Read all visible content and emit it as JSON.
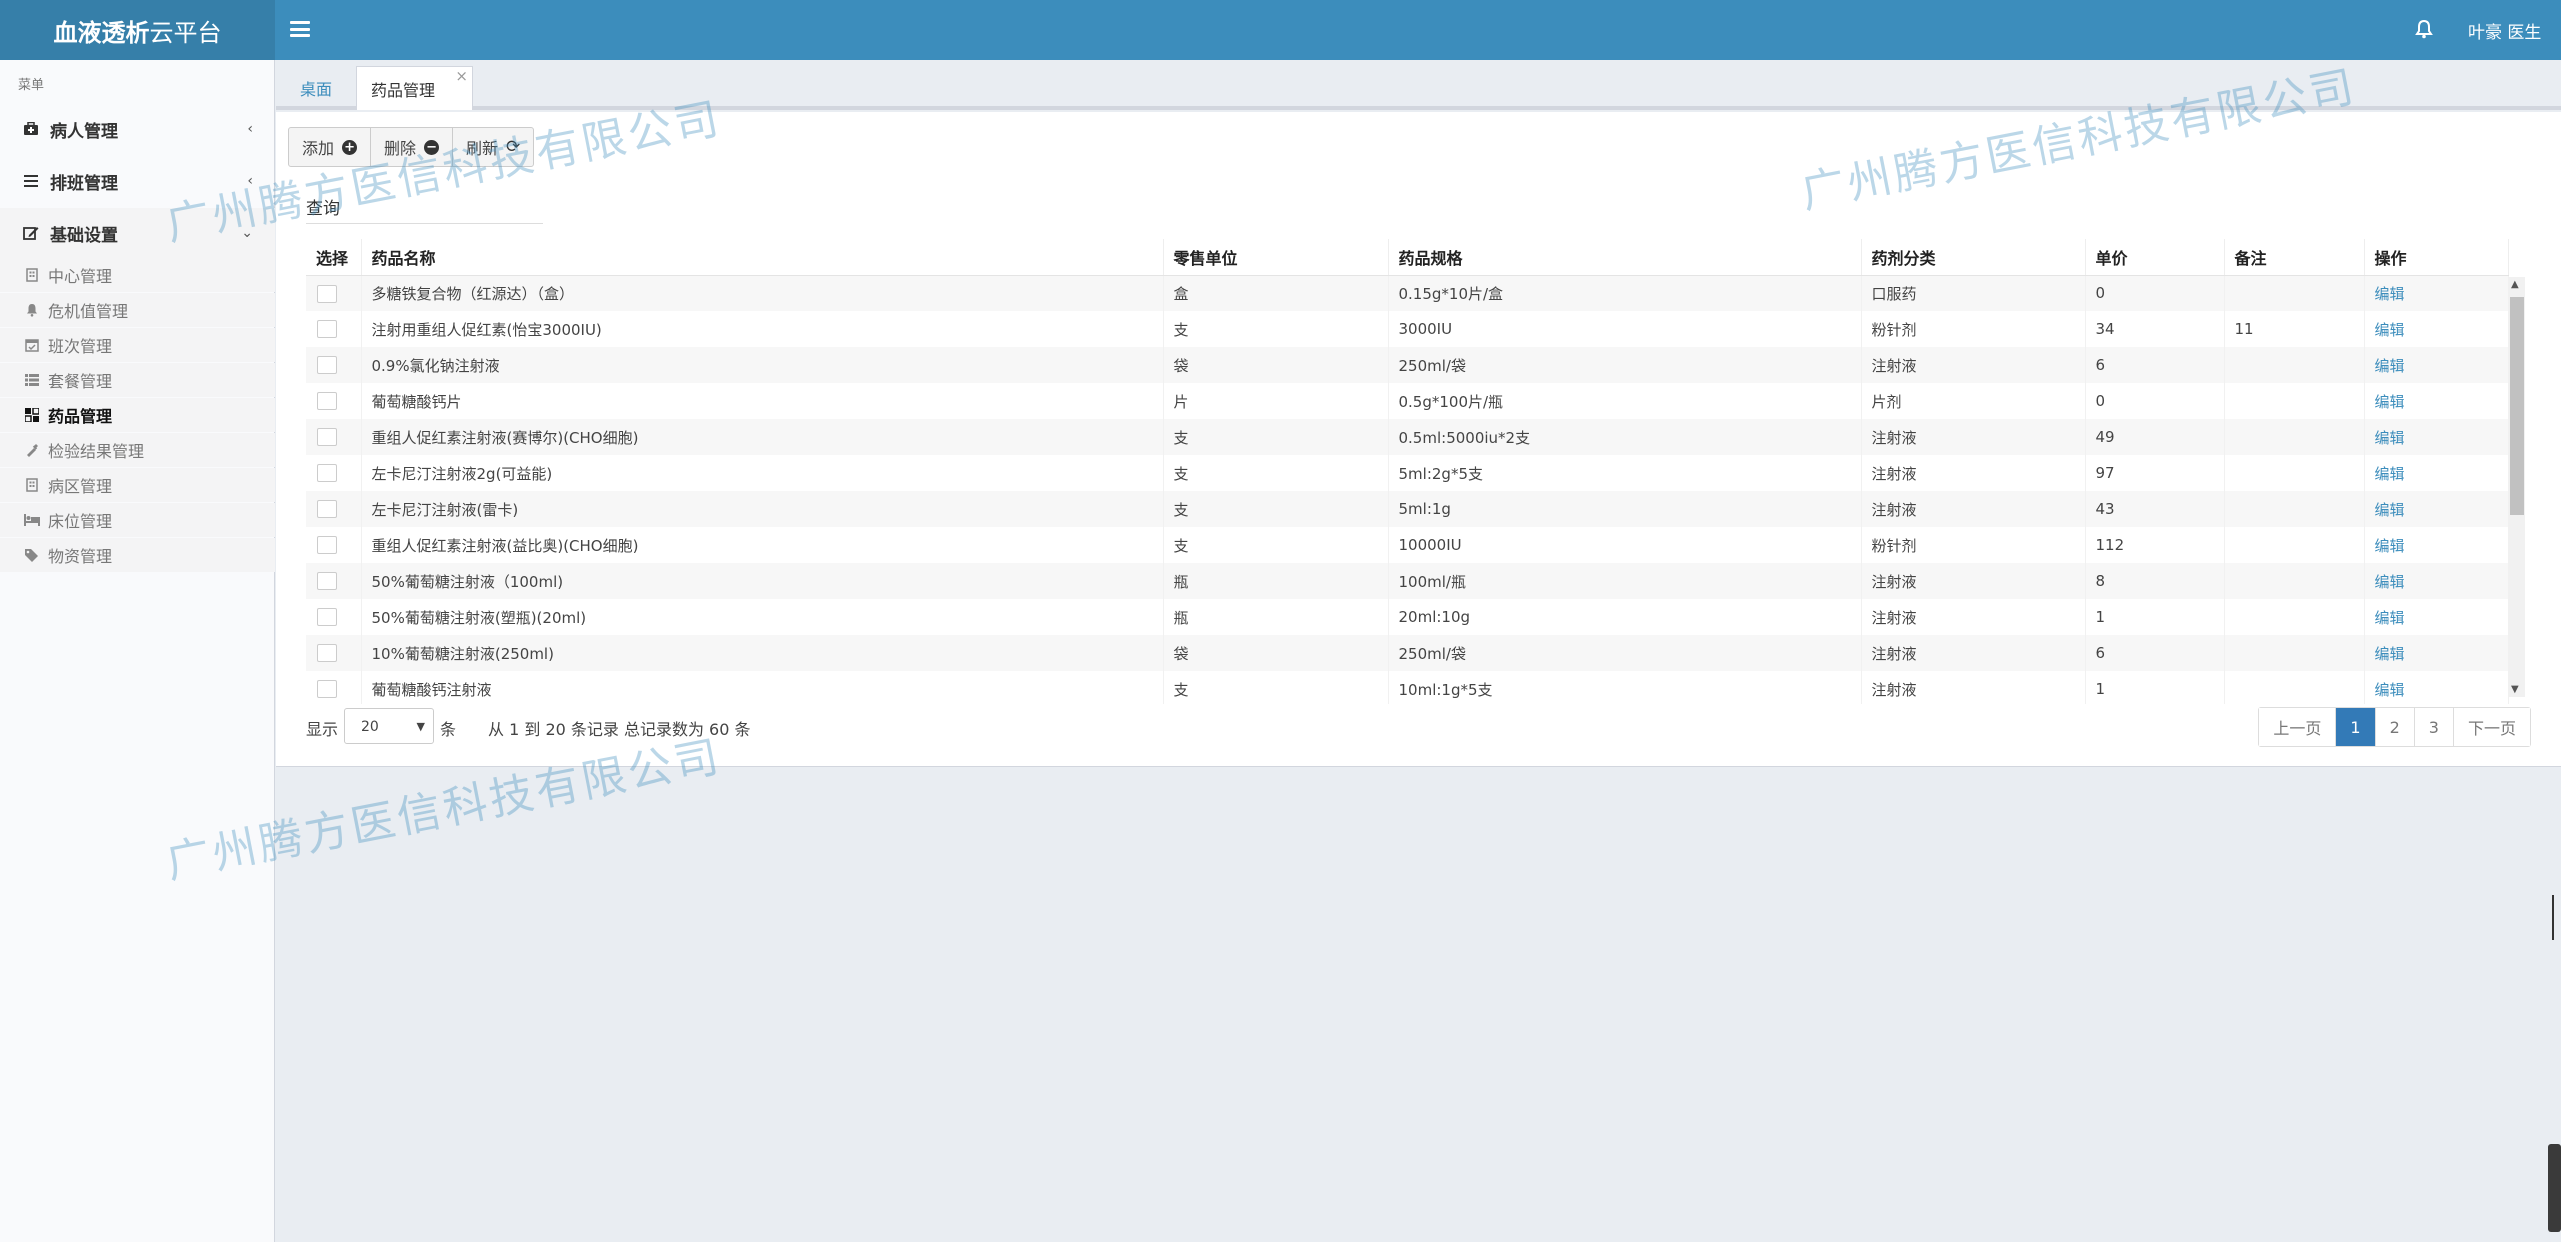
{
  "header": {
    "brand_bold": "血液透析",
    "brand_light": "云平台",
    "user": "叶豪 医生"
  },
  "sidebar": {
    "menu_header": "菜单",
    "main_items": [
      {
        "label": "病人管理",
        "icon": "medkit-icon",
        "chevron": "‹"
      },
      {
        "label": "排班管理",
        "icon": "list-icon",
        "chevron": "‹"
      },
      {
        "label": "基础设置",
        "icon": "edit-icon",
        "chevron": "⌄"
      }
    ],
    "sub_items": [
      {
        "label": "中心管理",
        "icon": "building-icon"
      },
      {
        "label": "危机值管理",
        "icon": "bell-icon"
      },
      {
        "label": "班次管理",
        "icon": "calendar-icon"
      },
      {
        "label": "套餐管理",
        "icon": "list-icon"
      },
      {
        "label": "药品管理",
        "icon": "drug-icon"
      },
      {
        "label": "检验结果管理",
        "icon": "dropper-icon"
      },
      {
        "label": "病区管理",
        "icon": "building-icon"
      },
      {
        "label": "床位管理",
        "icon": "bed-icon"
      },
      {
        "label": "物资管理",
        "icon": "tags-icon"
      }
    ]
  },
  "tabs": {
    "home": "桌面",
    "drug": "药品管理",
    "close": "×"
  },
  "toolbar": {
    "add": "添加",
    "delete": "删除",
    "refresh": "刷新",
    "query": "查询"
  },
  "table": {
    "columns": [
      "选择",
      "药品名称",
      "零售单位",
      "药品规格",
      "药剂分类",
      "单价",
      "备注",
      "操作"
    ],
    "edit_label": "编辑",
    "rows": [
      [
        "多糖铁复合物（红源达）（盒）",
        "盒",
        "0.15g*10片/盒",
        "口服药",
        "0",
        ""
      ],
      [
        "注射用重组人促红素(怡宝3000IU)",
        "支",
        "3000IU",
        "粉针剂",
        "34",
        "11"
      ],
      [
        "0.9%氯化钠注射液",
        "袋",
        "250ml/袋",
        "注射液",
        "6",
        ""
      ],
      [
        "葡萄糖酸钙片",
        "片",
        "0.5g*100片/瓶",
        "片剂",
        "0",
        ""
      ],
      [
        "重组人促红素注射液(赛博尔)(CHO细胞)",
        "支",
        "0.5ml:5000iu*2支",
        "注射液",
        "49",
        ""
      ],
      [
        "左卡尼汀注射液2g(可益能)",
        "支",
        "5ml:2g*5支",
        "注射液",
        "97",
        ""
      ],
      [
        "左卡尼汀注射液(雷卡)",
        "支",
        "5ml:1g",
        "注射液",
        "43",
        ""
      ],
      [
        "重组人促红素注射液(益比奥)(CHO细胞)",
        "支",
        "10000IU",
        "粉针剂",
        "112",
        ""
      ],
      [
        "50%葡萄糖注射液（100ml)",
        "瓶",
        "100ml/瓶",
        "注射液",
        "8",
        ""
      ],
      [
        "50%葡萄糖注射液(塑瓶)(20ml)",
        "瓶",
        "20ml:10g",
        "注射液",
        "1",
        ""
      ],
      [
        "10%葡萄糖注射液(250ml)",
        "袋",
        "250ml/袋",
        "注射液",
        "6",
        ""
      ],
      [
        "葡萄糖酸钙注射液",
        "支",
        "10ml:1g*5支",
        "注射液",
        "1",
        ""
      ]
    ]
  },
  "footer": {
    "show": "显示",
    "page_size": "20",
    "unit": "条",
    "records": "从 1 到 20 条记录 总记录数为 60 条",
    "prev": "上一页",
    "pages": [
      "1",
      "2",
      "3"
    ],
    "current_page": "1",
    "next": "下一页"
  },
  "watermark": "广州腾方医信科技有限公司"
}
